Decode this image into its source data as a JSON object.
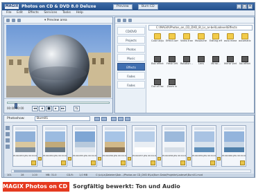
{
  "app": {
    "logo": "MAGIX",
    "title": "Photos on CD & DVD 8.0 Deluxe",
    "tabs": [
      "Preview",
      "Burn CD"
    ],
    "window_buttons": [
      "_",
      "□",
      "×"
    ]
  },
  "menu": [
    "File",
    "Edit",
    "Effects",
    "Services",
    "Tasks",
    "Help"
  ],
  "preview": {
    "selection_label": "▾ Preview area",
    "timecode": "00:00:00:00",
    "playback_buttons": [
      "◂◂",
      "◂",
      "■",
      "▸",
      "▸▸",
      "⇆"
    ]
  },
  "explorer": {
    "categories": [
      "CD/DVD",
      "Projects",
      "Photos",
      "Music",
      "Effects",
      "Fades",
      "Fades"
    ],
    "active_category": "Effects",
    "path": "C:\\MAGIX\\Photos_on_CD_DVD_8\\_Ls_ar-bel\\Ladevel\\Effects",
    "files": [
      {
        "name": "Color adjustm.",
        "kind": "folder"
      },
      {
        "name": "Effect combi..",
        "kind": "folder"
      },
      {
        "name": "Video transit..",
        "kind": "folder"
      },
      {
        "name": "Mustache mov..",
        "kind": "folder"
      },
      {
        "name": "Editing effects",
        "kind": "folder"
      },
      {
        "name": "auto measure",
        "kind": "folder"
      },
      {
        "name": "automatic 1",
        "kind": "folder"
      },
      {
        "name": "Box effect",
        "kind": "fx"
      },
      {
        "name": "Fresh left",
        "kind": "fx"
      },
      {
        "name": "Rotation ...",
        "kind": "fx"
      },
      {
        "name": "Lens",
        "kind": "fx"
      },
      {
        "name": "Mirror...",
        "kind": "fx"
      },
      {
        "name": "Mirror vertically",
        "kind": "fx"
      },
      {
        "name": "No effect",
        "kind": "fx"
      },
      {
        "name": "Out of Focus",
        "kind": "fx"
      },
      {
        "name": "Zoom in",
        "kind": "fx"
      }
    ]
  },
  "movie": {
    "label": "Photoshow:",
    "name": "Burn01",
    "clips": [
      {
        "caption": "P1010253.JPG 00:04:00"
      },
      {
        "caption": "P1010254.JPG 00:04:00"
      },
      {
        "caption": "P1010255.JPG 00:04:00"
      },
      {
        "caption": "P1010256.JPG 00:04:00"
      },
      {
        "caption": "P1010257.JPG 00:04:00"
      },
      {
        "caption": "P1010258.JPG 00:04:00"
      },
      {
        "caption": "P1010259.JPG 00:04:00"
      },
      {
        "caption": "P1010260.JPG 00:04:00"
      }
    ],
    "status": [
      "101",
      "28",
      "1:20",
      "MB: 31.0",
      "CD-R:",
      "1,0 MB",
      "C:\\Ls\\Ls\\Dateien\\Dok...\\Photos on CD_DVD 8\\Ls\\Burn Data\\Projekte\\Ladevel\\Burn01.mvd"
    ]
  },
  "caption": {
    "label": "MAGIX Photos on CD & DVD",
    "text": "Sorgfältig bewerkt: Ton und Audio"
  }
}
